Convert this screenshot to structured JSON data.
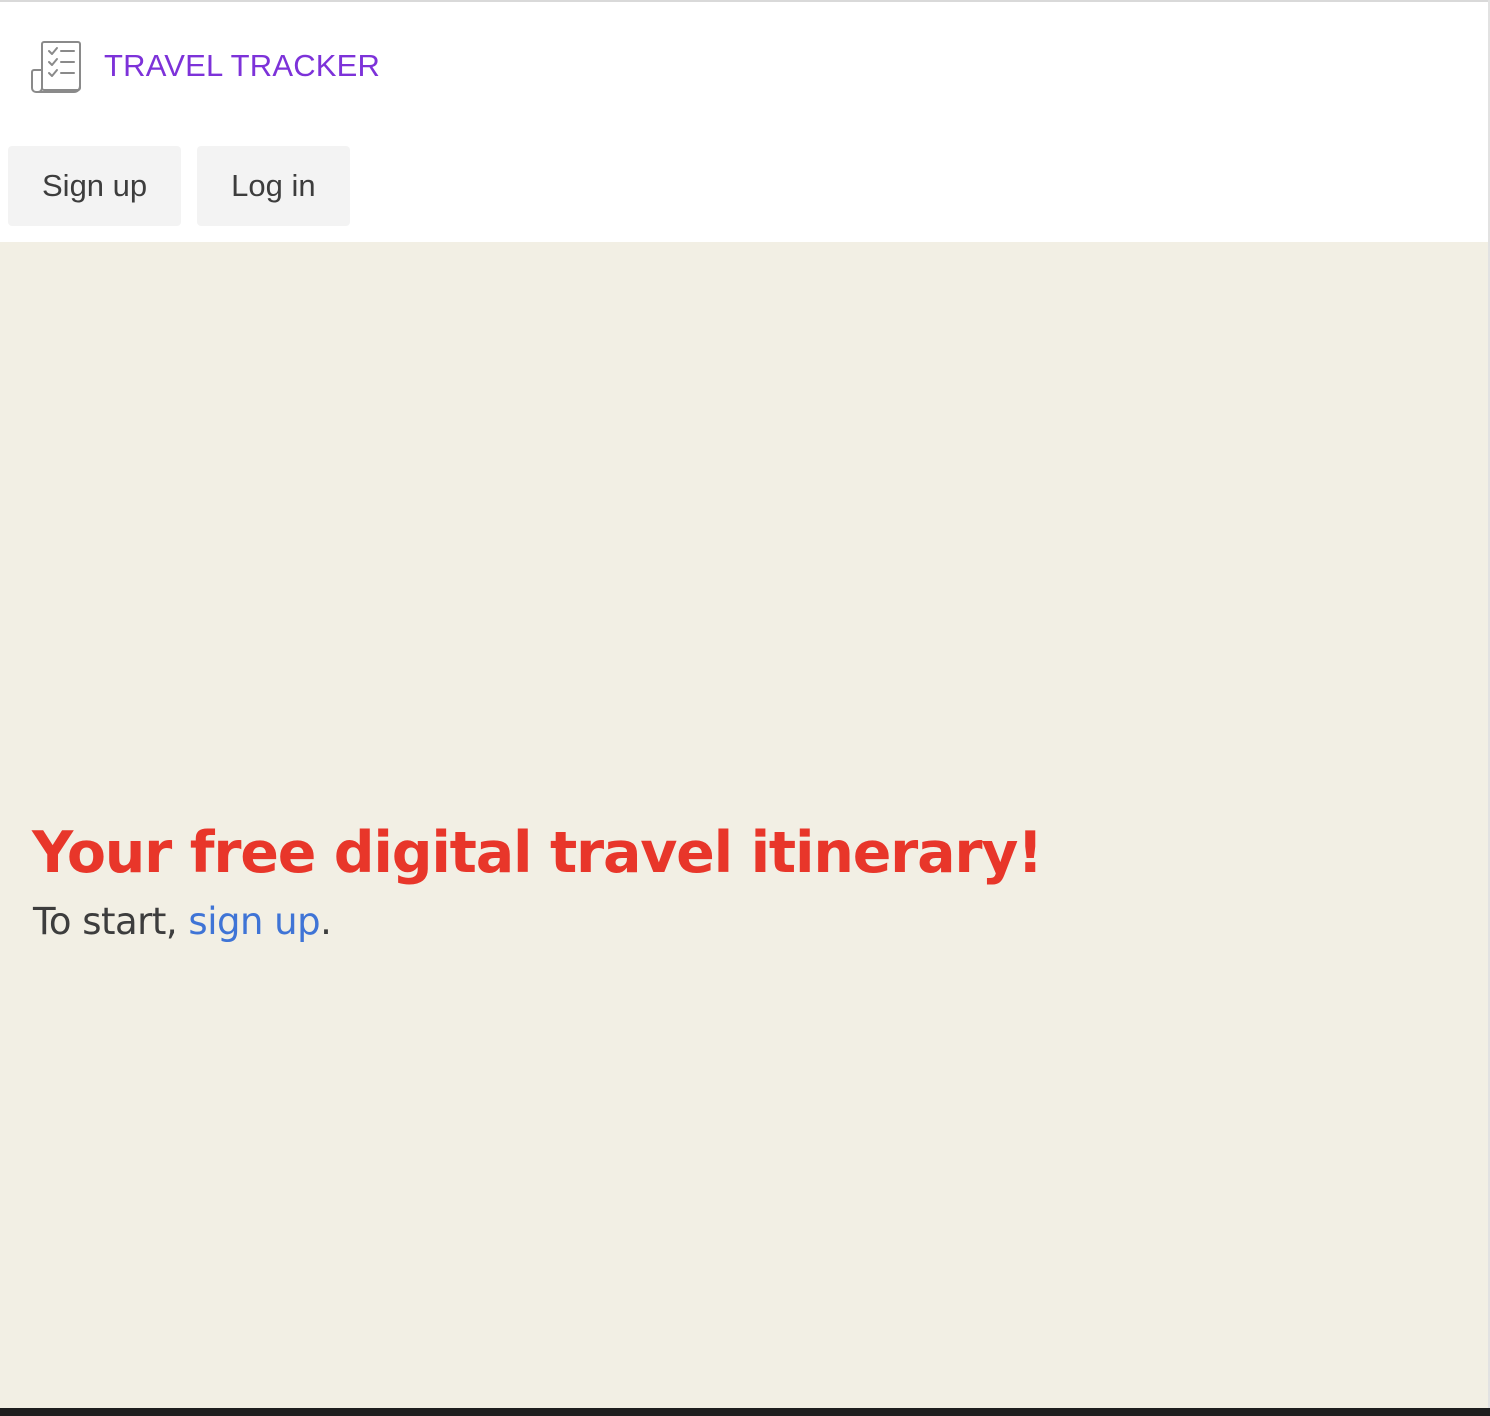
{
  "header": {
    "brand": {
      "icon": "checklist-map-icon",
      "title": "TRAVEL TRACKER",
      "title_color": "#7d32d9"
    },
    "nav": {
      "signup_label": "Sign up",
      "login_label": "Log in"
    }
  },
  "hero": {
    "background_color": "#f2efe4",
    "title": "Your free digital travel itinerary!",
    "title_color": "#e8362a",
    "subtitle_prefix": "To start, ",
    "subtitle_link": "sign up",
    "subtitle_suffix": ".",
    "link_color": "#3f74d6"
  }
}
